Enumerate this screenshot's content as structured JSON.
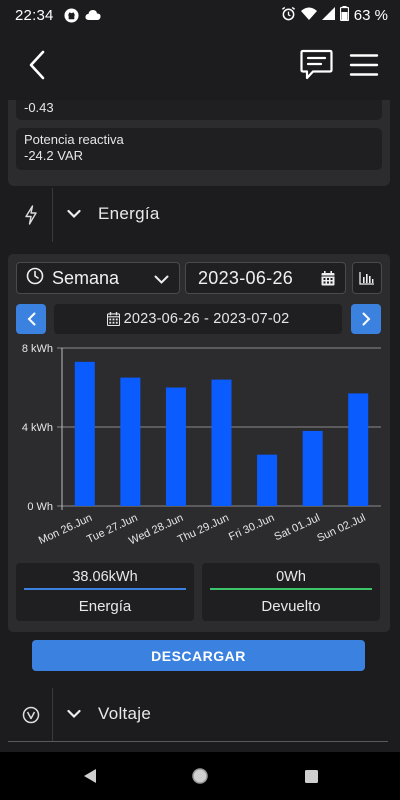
{
  "status_bar": {
    "time": "22:34",
    "battery": "63 %"
  },
  "previous_values": [
    {
      "label": "",
      "value": "-0.43"
    },
    {
      "label": "Potencia reactiva",
      "value": "-24.2 VAR"
    }
  ],
  "energy_section": {
    "title": "Energía"
  },
  "controls": {
    "period": "Semana",
    "date": "2023-06-26",
    "range": "2023-06-26 - 2023-07-02"
  },
  "chart_data": {
    "type": "bar",
    "categories": [
      "Mon 26.Jun",
      "Tue 27.Jun",
      "Wed 28.Jun",
      "Thu 29.Jun",
      "Fri 30.Jun",
      "Sat 01.Jul",
      "Sun 02.Jul"
    ],
    "series": [
      {
        "values": [
          7.3,
          6.5,
          6.0,
          6.4,
          2.6,
          3.8,
          5.7
        ]
      }
    ],
    "ylim": [
      0,
      8
    ],
    "yticks": [
      0,
      4,
      8
    ],
    "ytick_labels": [
      "0 Wh",
      "4 kWh",
      "8 kWh"
    ],
    "grid": true,
    "bar_color": "#0a5cff"
  },
  "summary": [
    {
      "value": "38.06kWh",
      "label": "Energía",
      "color": "#3b82e0"
    },
    {
      "value": "0Wh",
      "label": "Devuelto",
      "color": "#3cc46a"
    }
  ],
  "download_label": "DESCARGAR",
  "voltage_section": {
    "title": "Voltaje"
  },
  "colors": {
    "accent": "#3b82e0",
    "background": "#1c1c1e",
    "card": "#2c2c2e"
  }
}
